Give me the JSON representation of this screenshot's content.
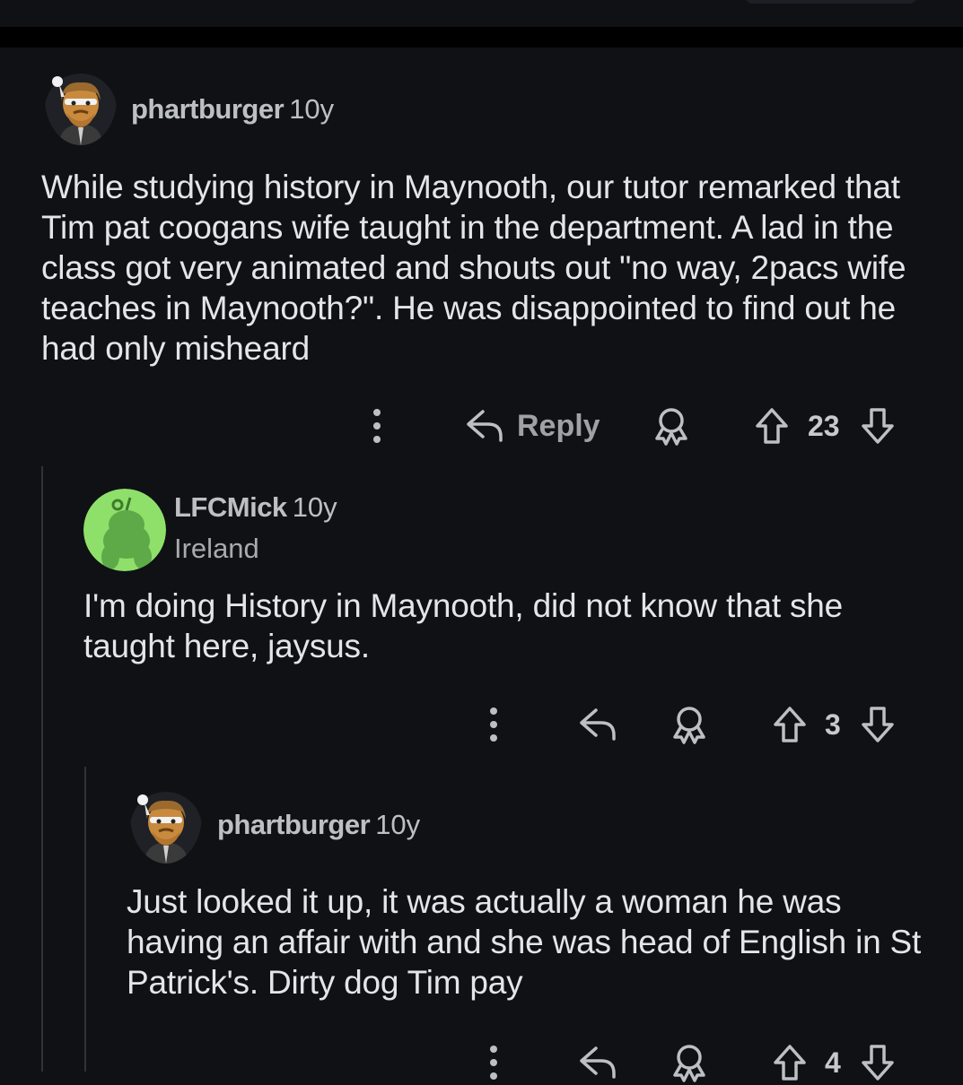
{
  "comments": [
    {
      "user": "phartburger",
      "age": "10y",
      "body": "While studying history in Maynooth, our tutor remarked that Tim pat coogans wife taught in the department. A lad in the class got very animated and shouts out \"no way, 2pacs wife teaches in Maynooth?\". He was disappointed to find out he had only misheard",
      "reply_label": "Reply",
      "score": "23"
    },
    {
      "user": "LFCMick",
      "age": "10y",
      "flair": "Ireland",
      "body": "I'm doing History in Maynooth, did not know that she taught here, jaysus.",
      "score": "3"
    },
    {
      "user": "phartburger",
      "age": "10y",
      "body": "Just looked it up, it was actually a woman he was having an affair with and she was head of English in St Patrick's. Dirty dog Tim pay",
      "score": "4"
    }
  ],
  "colors": {
    "background": "#0f1115",
    "text": "#e3e5e8",
    "muted": "#bcc0c4",
    "snoo_avatar": "#8ee06a"
  },
  "icons": [
    "more-vertical-icon",
    "reply-icon",
    "award-icon",
    "upvote-icon",
    "downvote-icon"
  ]
}
